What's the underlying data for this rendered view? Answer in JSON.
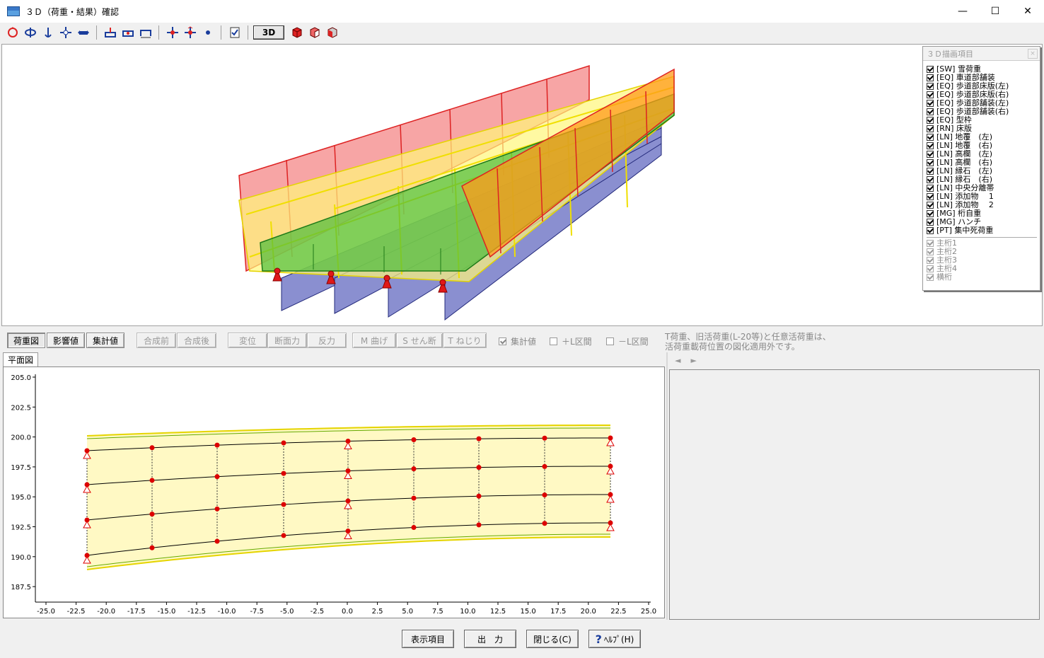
{
  "window": {
    "title": "３Ｄ（荷重・結果）確認",
    "minimize": "—",
    "maximize": "☐",
    "close": "✕"
  },
  "toolbar": {
    "three_d_label": "3D"
  },
  "legend": {
    "title": "３Ｄ描画項目",
    "close": "×",
    "items": [
      {
        "label": "[SW] 雪荷重"
      },
      {
        "label": "[EQ] 車道部舗装"
      },
      {
        "label": "[EQ] 歩道部床版(左)"
      },
      {
        "label": "[EQ] 歩道部床版(右)"
      },
      {
        "label": "[EQ] 歩道部舗装(左)"
      },
      {
        "label": "[EQ] 歩道部舗装(右)"
      },
      {
        "label": "[EQ] 型枠"
      },
      {
        "label": "[RN] 床版"
      },
      {
        "label": "[LN] 地覆　(左)"
      },
      {
        "label": "[LN] 地覆　(右)"
      },
      {
        "label": "[LN] 高欄　(左)"
      },
      {
        "label": "[LN] 高欄　(右)"
      },
      {
        "label": "[LN] 縁石　(左)"
      },
      {
        "label": "[LN] 縁石　(右)"
      },
      {
        "label": "[LN] 中央分離帯"
      },
      {
        "label": "[LN] 添加物　 1"
      },
      {
        "label": "[LN] 添加物　 2"
      },
      {
        "label": "[MG] 桁自重"
      },
      {
        "label": "[MG] ハンチ"
      },
      {
        "label": "[PT] 集中死荷重"
      }
    ],
    "girders": [
      {
        "label": "主桁1"
      },
      {
        "label": "主桁2"
      },
      {
        "label": "主桁3"
      },
      {
        "label": "主桁4"
      },
      {
        "label": "横桁"
      }
    ]
  },
  "tabs": {
    "load": "荷重図",
    "influence": "影響値",
    "design": "集計値",
    "before": "合成前",
    "after": "合成後",
    "disp": "変位",
    "force": "断面力",
    "reaction": "反力",
    "moment": "M 曲げ",
    "shear": "S せん断",
    "torsion": "T ねじり"
  },
  "checks": {
    "design_value": "集計値",
    "plus_l": "＋L区間",
    "minus_l": "－L区間"
  },
  "note": {
    "line1": "T荷重、旧活荷重(L-20等)と任意活荷重は、",
    "line2": "活荷重載荷位置の図化適用外です。"
  },
  "plan": {
    "tab": "平面図",
    "nav_left": "◄",
    "nav_right": "►",
    "yticks": [
      "205.0",
      "202.5",
      "200.0",
      "197.5",
      "195.0",
      "192.5",
      "190.0",
      "187.5"
    ],
    "xticks": [
      "-25.0",
      "-22.5",
      "-20.0",
      "-17.5",
      "-15.0",
      "-12.5",
      "-10.0",
      "-7.5",
      "-5.0",
      "-2.5",
      "0.0",
      "2.5",
      "5.0",
      "7.5",
      "10.0",
      "12.5",
      "15.0",
      "17.5",
      "20.0",
      "22.5",
      "25.0"
    ]
  },
  "buttons": {
    "display": "表示項目",
    "output": "出　力",
    "close": "閉じる(C)",
    "help": "ﾍﾙﾌﾟ(H)",
    "help_q": "?"
  }
}
